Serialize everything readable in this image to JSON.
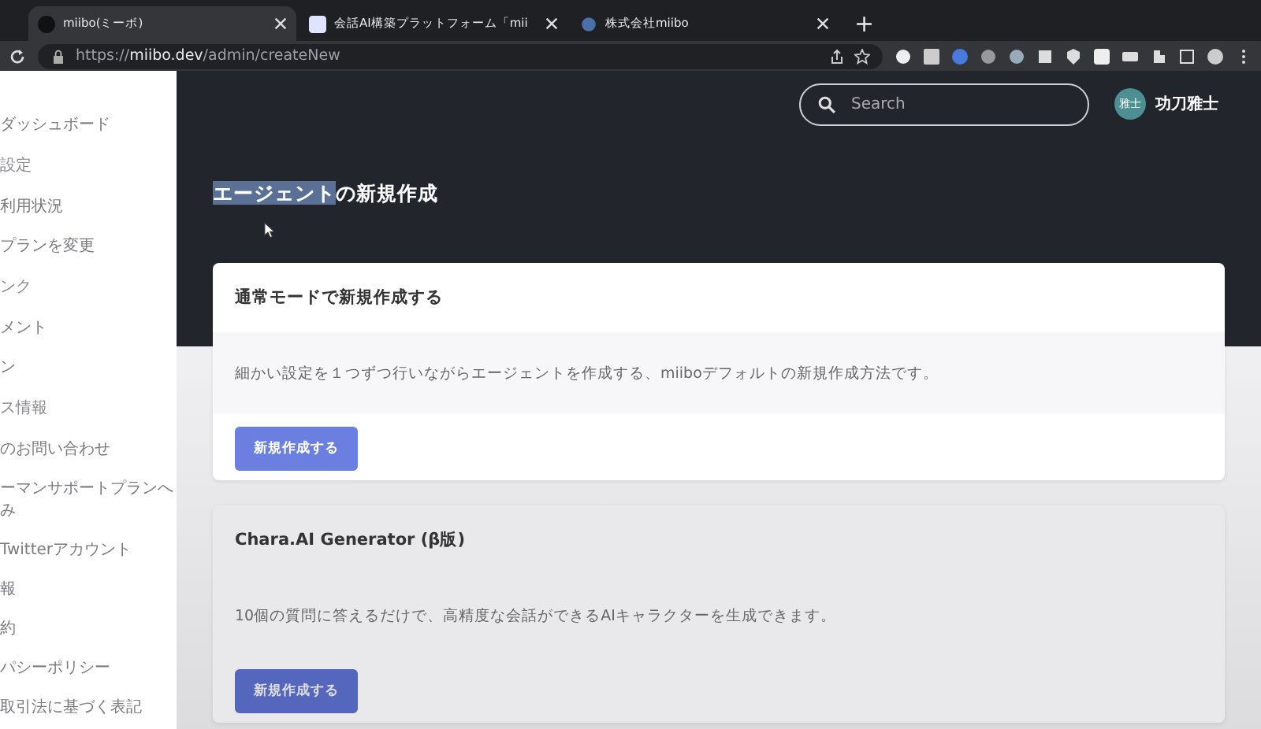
{
  "browser": {
    "tabs": [
      {
        "title": "miibo(ミーボ)",
        "selected": true
      },
      {
        "title": "会話AI構築プラットフォーム「mii",
        "selected": false
      },
      {
        "title": "株式会社miibo",
        "selected": false
      }
    ],
    "new_tab": "+",
    "url": {
      "scheme": "https://",
      "host": "miibo.dev",
      "path": "/admin/createNew"
    }
  },
  "sidebar": {
    "items": [
      {
        "kind": "link",
        "label": "ダッシュボード"
      },
      {
        "kind": "heading",
        "label": "設定"
      },
      {
        "kind": "link",
        "label": "利用状況"
      },
      {
        "kind": "link",
        "label": "プランを変更"
      },
      {
        "kind": "heading",
        "label": "ンク"
      },
      {
        "kind": "link",
        "label": "メント"
      },
      {
        "kind": "link",
        "label": "ン"
      },
      {
        "kind": "heading",
        "label": "ス情報"
      },
      {
        "kind": "link",
        "label": "のお問い合わせ"
      },
      {
        "kind": "link",
        "label": "ーマンサポートプランへみ"
      },
      {
        "kind": "link",
        "label": "Twitterアカウント"
      },
      {
        "kind": "link",
        "label": "報"
      },
      {
        "kind": "link",
        "label": "約"
      },
      {
        "kind": "link",
        "label": "パシーポリシー"
      },
      {
        "kind": "link",
        "label": "取引法に基づく表記"
      }
    ]
  },
  "header": {
    "search": {
      "placeholder": "Search"
    },
    "user": {
      "avatar_text": "雅士",
      "name": "功刀雅士"
    }
  },
  "page": {
    "title": [
      {
        "text": "エージェント",
        "selected": true
      },
      {
        "text": "の新規作成",
        "selected": false
      }
    ],
    "cards": [
      {
        "title": "通常モードで新規作成する",
        "description": "細かい設定を１つずつ行いながらエージェントを作成する、miiboデフォルトの新規作成方法です。",
        "button": "新規作成する"
      },
      {
        "title": "Chara.AI Generator (β版)",
        "description": "10個の質問に答えるだけで、高精度な会話ができるAIキャラクターを生成できます。",
        "button": "新規作成する"
      }
    ]
  }
}
